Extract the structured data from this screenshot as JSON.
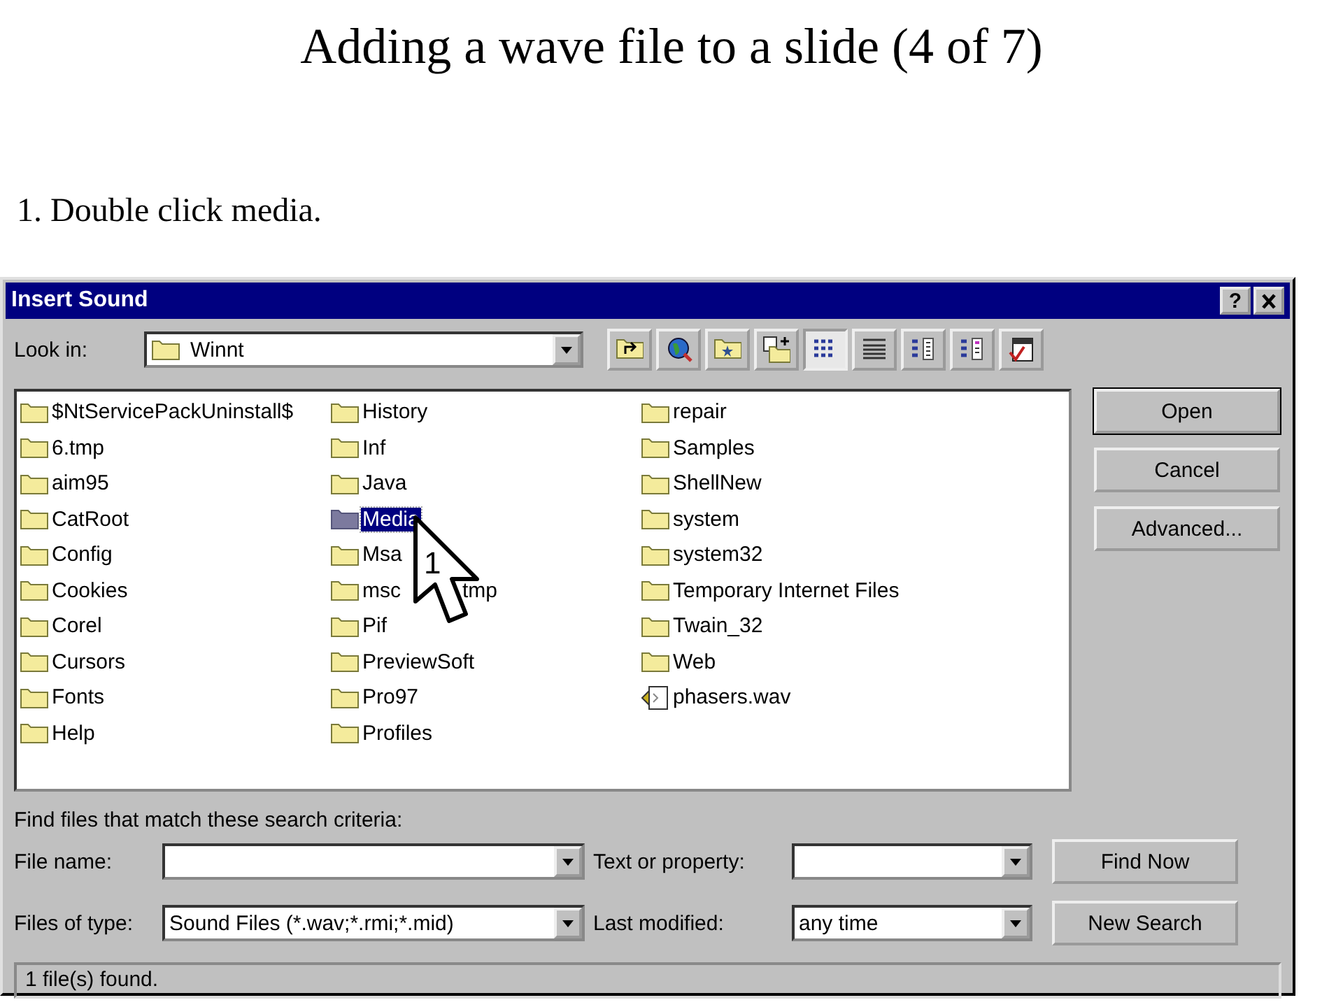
{
  "slide": {
    "title": "Adding a wave file to a slide  (4 of 7)",
    "instruction": "1. Double click media."
  },
  "window": {
    "title": "Insert Sound",
    "help_button": "?"
  },
  "look_in": {
    "label": "Look in:",
    "value": "Winnt"
  },
  "toolbar": [
    {
      "kind": "up",
      "selected": false
    },
    {
      "kind": "web",
      "selected": false
    },
    {
      "kind": "favorites",
      "selected": false
    },
    {
      "kind": "add-favorite",
      "selected": false
    },
    {
      "kind": "list",
      "selected": true
    },
    {
      "kind": "details",
      "selected": false
    },
    {
      "kind": "properties",
      "selected": false
    },
    {
      "kind": "preview",
      "selected": false
    },
    {
      "kind": "tools",
      "selected": false
    }
  ],
  "files": [
    {
      "kind": "folder",
      "name": "$NtServicePackUninstall$",
      "selected": false
    },
    {
      "kind": "folder",
      "name": "6.tmp",
      "selected": false
    },
    {
      "kind": "folder",
      "name": "aim95",
      "selected": false
    },
    {
      "kind": "folder",
      "name": "CatRoot",
      "selected": false
    },
    {
      "kind": "folder",
      "name": "Config",
      "selected": false
    },
    {
      "kind": "folder",
      "name": "Cookies",
      "selected": false
    },
    {
      "kind": "folder",
      "name": "Corel",
      "selected": false
    },
    {
      "kind": "folder",
      "name": "Cursors",
      "selected": false
    },
    {
      "kind": "folder",
      "name": "Fonts",
      "selected": false
    },
    {
      "kind": "folder",
      "name": "Help",
      "selected": false
    },
    {
      "kind": "folder",
      "name": "History",
      "selected": false
    },
    {
      "kind": "folder",
      "name": "Inf",
      "selected": false
    },
    {
      "kind": "folder",
      "name": "Java",
      "selected": false
    },
    {
      "kind": "folder",
      "name": "Media",
      "selected": true
    },
    {
      "kind": "folder",
      "name": "Msa",
      "selected": false
    },
    {
      "kind": "folder",
      "name": "msc",
      "name_end": "tmp",
      "selected": false
    },
    {
      "kind": "folder",
      "name": "Pif",
      "selected": false
    },
    {
      "kind": "folder",
      "name": "PreviewSoft",
      "selected": false
    },
    {
      "kind": "folder",
      "name": "Pro97",
      "selected": false
    },
    {
      "kind": "folder",
      "name": "Profiles",
      "selected": false
    },
    {
      "kind": "folder",
      "name": "repair",
      "selected": false
    },
    {
      "kind": "folder",
      "name": "Samples",
      "selected": false
    },
    {
      "kind": "folder",
      "name": "ShellNew",
      "selected": false
    },
    {
      "kind": "folder",
      "name": "system",
      "selected": false
    },
    {
      "kind": "folder",
      "name": "system32",
      "selected": false
    },
    {
      "kind": "folder",
      "name": "Temporary Internet Files",
      "selected": false
    },
    {
      "kind": "folder",
      "name": "Twain_32",
      "selected": false
    },
    {
      "kind": "folder",
      "name": "Web",
      "selected": false
    },
    {
      "kind": "sound",
      "name": "phasers.wav",
      "selected": false
    }
  ],
  "cursor": {
    "label": "1"
  },
  "side_buttons": [
    {
      "label": "Open",
      "default": true
    },
    {
      "label": "Cancel",
      "default": false
    },
    {
      "label": "Advanced...",
      "default": false
    }
  ],
  "criteria": {
    "heading": "Find files that match these search criteria:",
    "fields": [
      {
        "label": "File name:"
      },
      {
        "label": "Text or property:"
      },
      {
        "label": "Files of type:",
        "value": "Sound Files (*.wav;*.rmi;*.mid)"
      },
      {
        "label": "Last modified:",
        "value": "any time"
      }
    ],
    "buttons": [
      "Find Now",
      "New Search"
    ]
  },
  "status_bar": "1 file(s) found."
}
